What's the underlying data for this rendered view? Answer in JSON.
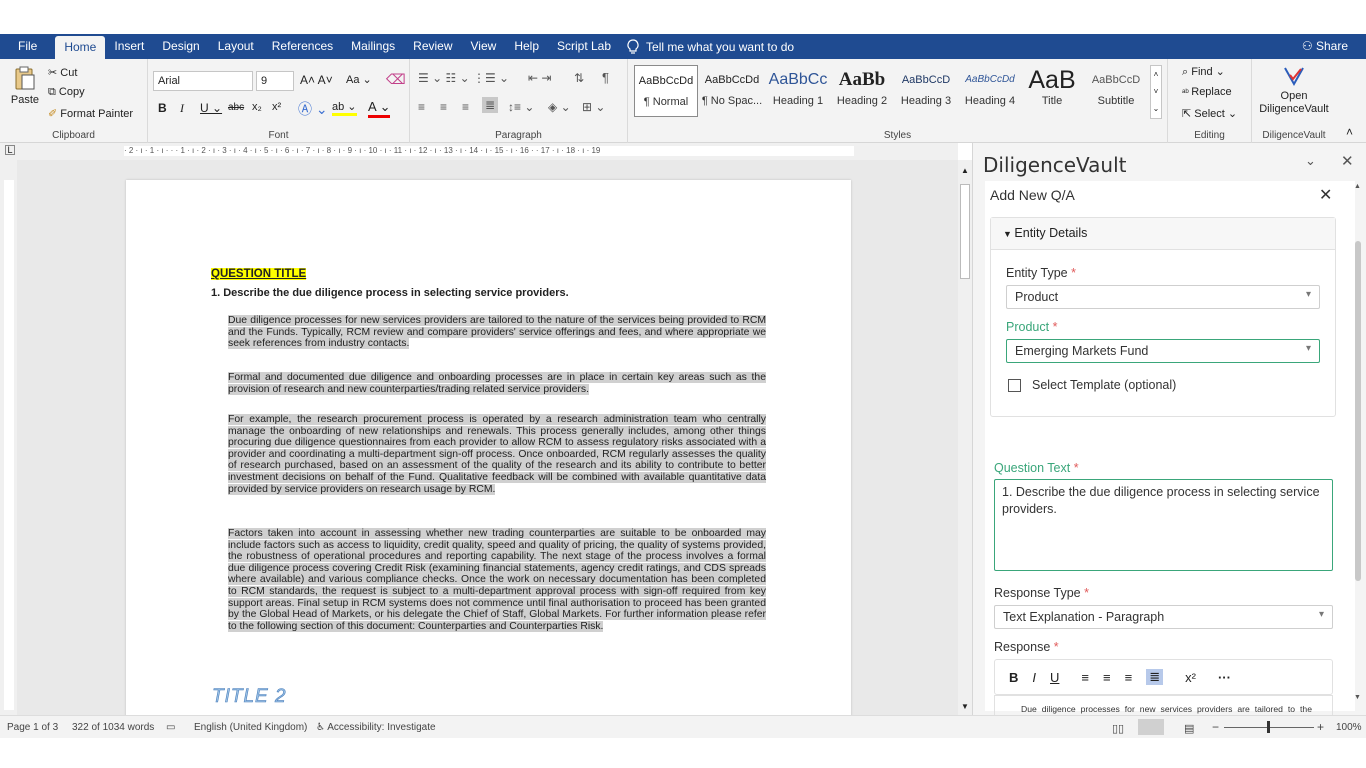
{
  "menu": {
    "tabs": [
      "File",
      "Home",
      "Insert",
      "Design",
      "Layout",
      "References",
      "Mailings",
      "Review",
      "View",
      "Help",
      "Script Lab"
    ],
    "active": "Home",
    "tellme": "Tell me what you want to do",
    "share": "Share"
  },
  "ribbon": {
    "clipboard": {
      "paste": "Paste",
      "cut": "Cut",
      "copy": "Copy",
      "format_painter": "Format Painter",
      "label": "Clipboard"
    },
    "font": {
      "name": "Arial",
      "size": "9",
      "aa": "Aa",
      "label": "Font"
    },
    "paragraph": {
      "label": "Paragraph"
    },
    "styles": {
      "items": [
        {
          "sample": "AaBbCcDd",
          "name": "¶ Normal"
        },
        {
          "sample": "AaBbCcDd",
          "name": "¶ No Spac..."
        },
        {
          "sample": "AaBbCc",
          "name": "Heading 1"
        },
        {
          "sample": "AaBb",
          "name": "Heading 2"
        },
        {
          "sample": "AaBbCcD",
          "name": "Heading 3"
        },
        {
          "sample": "AaBbCcDd",
          "name": "Heading 4"
        },
        {
          "sample": "AaB",
          "name": "Title"
        },
        {
          "sample": "AaBbCcD",
          "name": "Subtitle"
        }
      ],
      "label": "Styles"
    },
    "editing": {
      "find": "Find",
      "replace": "Replace",
      "select": "Select",
      "label": "Editing"
    },
    "dv": {
      "line1": "Open",
      "line2": "DiligenceVault",
      "label": "DiligenceVault"
    }
  },
  "ruler": "· 2 · ı · 1 · ı ·   ·  · 1 · ı · 2 · ı · 3 · ı · 4 · ı · 5 · ı · 6 · ı · 7 · ı · 8 · ı · 9 · ı · 10 · ı · 11 · ı · 12 · ı · 13 · ı · 14 · ı · 15 · ı · 16 ·  · 17 · ı · 18 · ı · 19",
  "document": {
    "question_title": "QUESTION TITLE",
    "question": "1.  Describe the due diligence process in selecting service providers.",
    "paragraphs": [
      "Due diligence processes for new services providers are tailored to the nature of the services being provided to RCM and the Funds. Typically, RCM review and compare providers' service offerings and fees, and where appropriate we seek references from industry contacts.",
      "Formal and documented due diligence and onboarding processes are in place in certain key areas such as the provision of research and new counterparties/trading related service providers.",
      "For example, the research procurement process is operated by a research administration team who centrally manage the onboarding of new relationships and renewals. This process generally includes, among other things procuring due diligence questionnaires from each provider to allow RCM to assess regulatory risks associated with a provider and coordinating a multi-department sign-off process. Once onboarded, RCM regularly assesses the quality of research purchased, based on an assessment of the quality of the research and its ability to contribute to better investment decisions on behalf of the Fund.  Qualitative feedback will be combined with available quantitative data provided by service providers on research usage by RCM.",
      "Factors taken into account in assessing whether new trading counterparties are suitable to be onboarded may include factors such as access to liquidity, credit quality, speed and quality of pricing, the quality of systems provided, the robustness of operational procedures and reporting capability. The next stage of the process involves a formal due diligence process covering Credit Risk (examining financial statements, agency credit ratings, and CDS spreads where available) and various compliance checks. Once the work on necessary documentation has been completed to RCM standards, the request is subject to a multi-department approval process with sign-off required from key support areas. Final setup in RCM systems does not commence until final authorisation to proceed has been granted by the Global Head of Markets, or his delegate the Chief of Staff, Global Markets. For further information please refer to the following section of this document: Counterparties and Counterparties Risk."
    ],
    "title2": "TITLE 2"
  },
  "pane": {
    "title": "DiligenceVault",
    "add_new": "Add New Q/A",
    "entity_details": "Entity Details",
    "entity_type_label": "Entity Type",
    "entity_type_value": "Product",
    "product_label": "Product",
    "product_value": "Emerging Markets Fund",
    "select_template": "Select Template (optional)",
    "question_text_label": "Question Text",
    "question_text_value": "1. Describe the due diligence process in selecting service providers.",
    "response_type_label": "Response Type",
    "response_type_value": "Text Explanation - Paragraph",
    "response_label": "Response",
    "required_mark": "*",
    "response_preview": "Due diligence processes for new services providers are tailored to the nature of the services being provided to RCM and the Funds. Typically, RCM review and compare providers' service offerings and fees, and where"
  },
  "status": {
    "page": "Page 1 of 3",
    "words": "322 of 1034 words",
    "language": "English (United Kingdom)",
    "accessibility": "Accessibility: Investigate",
    "zoom": "100%"
  },
  "colors": {
    "menubar": "#1f4b91",
    "accent_green": "#3aa67a",
    "required": "#e05a5a",
    "highlight": "#ffff00"
  }
}
